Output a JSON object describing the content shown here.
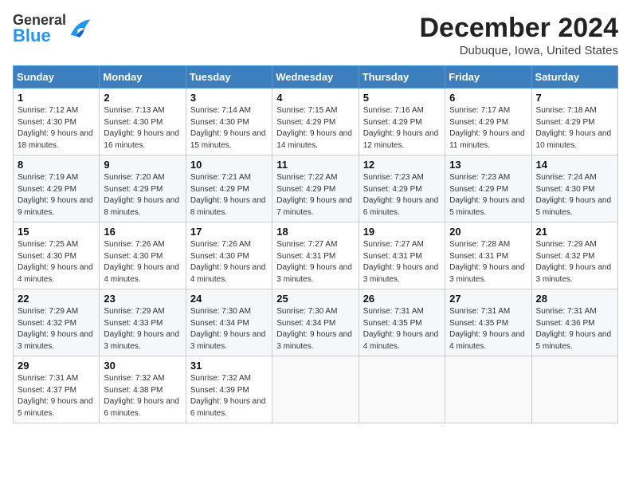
{
  "header": {
    "logo_general": "General",
    "logo_blue": "Blue",
    "month_title": "December 2024",
    "subtitle": "Dubuque, Iowa, United States"
  },
  "days_of_week": [
    "Sunday",
    "Monday",
    "Tuesday",
    "Wednesday",
    "Thursday",
    "Friday",
    "Saturday"
  ],
  "weeks": [
    [
      {
        "day": "1",
        "sunrise": "7:12 AM",
        "sunset": "4:30 PM",
        "daylight": "9 hours and 18 minutes."
      },
      {
        "day": "2",
        "sunrise": "7:13 AM",
        "sunset": "4:30 PM",
        "daylight": "9 hours and 16 minutes."
      },
      {
        "day": "3",
        "sunrise": "7:14 AM",
        "sunset": "4:30 PM",
        "daylight": "9 hours and 15 minutes."
      },
      {
        "day": "4",
        "sunrise": "7:15 AM",
        "sunset": "4:29 PM",
        "daylight": "9 hours and 14 minutes."
      },
      {
        "day": "5",
        "sunrise": "7:16 AM",
        "sunset": "4:29 PM",
        "daylight": "9 hours and 12 minutes."
      },
      {
        "day": "6",
        "sunrise": "7:17 AM",
        "sunset": "4:29 PM",
        "daylight": "9 hours and 11 minutes."
      },
      {
        "day": "7",
        "sunrise": "7:18 AM",
        "sunset": "4:29 PM",
        "daylight": "9 hours and 10 minutes."
      }
    ],
    [
      {
        "day": "8",
        "sunrise": "7:19 AM",
        "sunset": "4:29 PM",
        "daylight": "9 hours and 9 minutes."
      },
      {
        "day": "9",
        "sunrise": "7:20 AM",
        "sunset": "4:29 PM",
        "daylight": "9 hours and 8 minutes."
      },
      {
        "day": "10",
        "sunrise": "7:21 AM",
        "sunset": "4:29 PM",
        "daylight": "9 hours and 8 minutes."
      },
      {
        "day": "11",
        "sunrise": "7:22 AM",
        "sunset": "4:29 PM",
        "daylight": "9 hours and 7 minutes."
      },
      {
        "day": "12",
        "sunrise": "7:23 AM",
        "sunset": "4:29 PM",
        "daylight": "9 hours and 6 minutes."
      },
      {
        "day": "13",
        "sunrise": "7:23 AM",
        "sunset": "4:29 PM",
        "daylight": "9 hours and 5 minutes."
      },
      {
        "day": "14",
        "sunrise": "7:24 AM",
        "sunset": "4:30 PM",
        "daylight": "9 hours and 5 minutes."
      }
    ],
    [
      {
        "day": "15",
        "sunrise": "7:25 AM",
        "sunset": "4:30 PM",
        "daylight": "9 hours and 4 minutes."
      },
      {
        "day": "16",
        "sunrise": "7:26 AM",
        "sunset": "4:30 PM",
        "daylight": "9 hours and 4 minutes."
      },
      {
        "day": "17",
        "sunrise": "7:26 AM",
        "sunset": "4:30 PM",
        "daylight": "9 hours and 4 minutes."
      },
      {
        "day": "18",
        "sunrise": "7:27 AM",
        "sunset": "4:31 PM",
        "daylight": "9 hours and 3 minutes."
      },
      {
        "day": "19",
        "sunrise": "7:27 AM",
        "sunset": "4:31 PM",
        "daylight": "9 hours and 3 minutes."
      },
      {
        "day": "20",
        "sunrise": "7:28 AM",
        "sunset": "4:31 PM",
        "daylight": "9 hours and 3 minutes."
      },
      {
        "day": "21",
        "sunrise": "7:29 AM",
        "sunset": "4:32 PM",
        "daylight": "9 hours and 3 minutes."
      }
    ],
    [
      {
        "day": "22",
        "sunrise": "7:29 AM",
        "sunset": "4:32 PM",
        "daylight": "9 hours and 3 minutes."
      },
      {
        "day": "23",
        "sunrise": "7:29 AM",
        "sunset": "4:33 PM",
        "daylight": "9 hours and 3 minutes."
      },
      {
        "day": "24",
        "sunrise": "7:30 AM",
        "sunset": "4:34 PM",
        "daylight": "9 hours and 3 minutes."
      },
      {
        "day": "25",
        "sunrise": "7:30 AM",
        "sunset": "4:34 PM",
        "daylight": "9 hours and 3 minutes."
      },
      {
        "day": "26",
        "sunrise": "7:31 AM",
        "sunset": "4:35 PM",
        "daylight": "9 hours and 4 minutes."
      },
      {
        "day": "27",
        "sunrise": "7:31 AM",
        "sunset": "4:35 PM",
        "daylight": "9 hours and 4 minutes."
      },
      {
        "day": "28",
        "sunrise": "7:31 AM",
        "sunset": "4:36 PM",
        "daylight": "9 hours and 5 minutes."
      }
    ],
    [
      {
        "day": "29",
        "sunrise": "7:31 AM",
        "sunset": "4:37 PM",
        "daylight": "9 hours and 5 minutes."
      },
      {
        "day": "30",
        "sunrise": "7:32 AM",
        "sunset": "4:38 PM",
        "daylight": "9 hours and 6 minutes."
      },
      {
        "day": "31",
        "sunrise": "7:32 AM",
        "sunset": "4:39 PM",
        "daylight": "9 hours and 6 minutes."
      },
      null,
      null,
      null,
      null
    ]
  ],
  "labels": {
    "sunrise": "Sunrise:",
    "sunset": "Sunset:",
    "daylight": "Daylight:"
  }
}
